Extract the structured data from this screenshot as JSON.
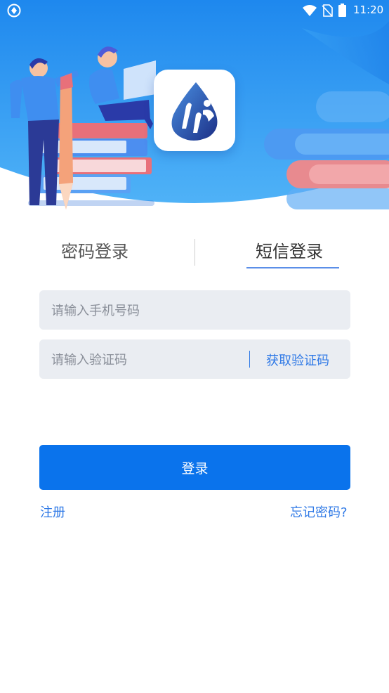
{
  "status_bar": {
    "time": "11:20",
    "icons": [
      "app-notification-icon",
      "wifi-icon",
      "no-sim-icon",
      "battery-icon"
    ]
  },
  "hero": {
    "illustration": "people-with-books-and-pen",
    "logo_icon": "app-logo-icon"
  },
  "tabs": [
    {
      "label": "密码登录",
      "active": false
    },
    {
      "label": "短信登录",
      "active": true
    }
  ],
  "form": {
    "phone_placeholder": "请输入手机号码",
    "code_placeholder": "请输入验证码",
    "get_code_label": "获取验证码"
  },
  "actions": {
    "login_label": "登录",
    "register_label": "注册",
    "forgot_label": "忘记密码?"
  },
  "colors": {
    "primary": "#0a73ec",
    "link": "#2f79e6",
    "hero_top": "#1f8ff0",
    "input_bg": "#eaedf2"
  }
}
